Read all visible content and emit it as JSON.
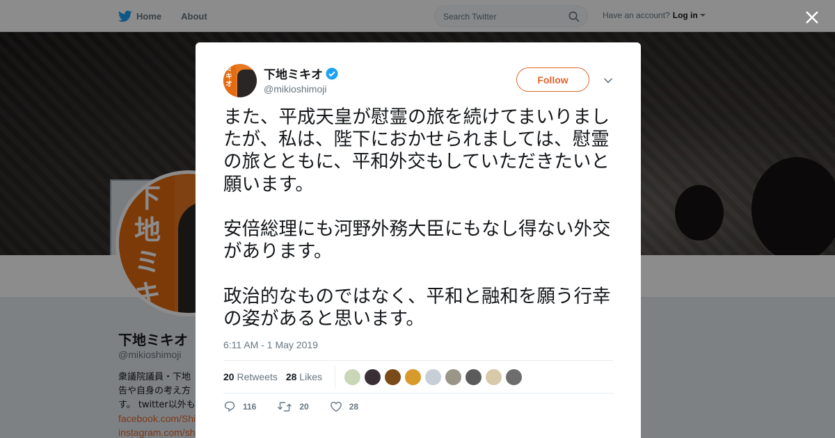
{
  "nav": {
    "home_label": "Home",
    "about_label": "About",
    "search_placeholder": "Search Twitter",
    "account_prompt": "Have an account?",
    "login_label": "Log in"
  },
  "background_profile": {
    "name": "下地ミキオ",
    "handle": "@mikioshimoji",
    "bio_lines": [
      "衆議院議員・下地",
      "告や自身の考え方",
      "す。 twitter以外も"
    ],
    "links": [
      "facebook.com/Shi",
      "instagram.com/sh"
    ],
    "avatar_text": "下地\nミキオ"
  },
  "tweet": {
    "author_name": "下地ミキオ",
    "author_handle": "@mikioshimoji",
    "follow_label": "Follow",
    "paragraphs": [
      "また、平成天皇が慰霊の旅を続けてまいりましたが、私は、陛下におかせられましては、慰霊の旅とともに、平和外交もしていただきたいと願います。",
      "安倍総理にも河野外務大臣にもなし得ない外交があります。",
      "政治的なものではなく、平和と融和を願う行幸の姿があると思います。"
    ],
    "timestamp": "6:11 AM - 1 May 2019",
    "retweets_count": "20",
    "retweets_label": "Retweets",
    "likes_count": "28",
    "likes_label": "Likes",
    "liker_colors": [
      "#c9d6b8",
      "#3b2f36",
      "#7a4a18",
      "#d89a2a",
      "#c7ced6",
      "#9b9588",
      "#5b5b5b",
      "#d8c9a8",
      "#6d6d6d"
    ],
    "reply_count": "116",
    "retweet_action_count": "20",
    "like_action_count": "28"
  },
  "colors": {
    "accent": "#e0652b",
    "verified": "#1da1f2",
    "twitter_blue": "#1da1f2"
  }
}
